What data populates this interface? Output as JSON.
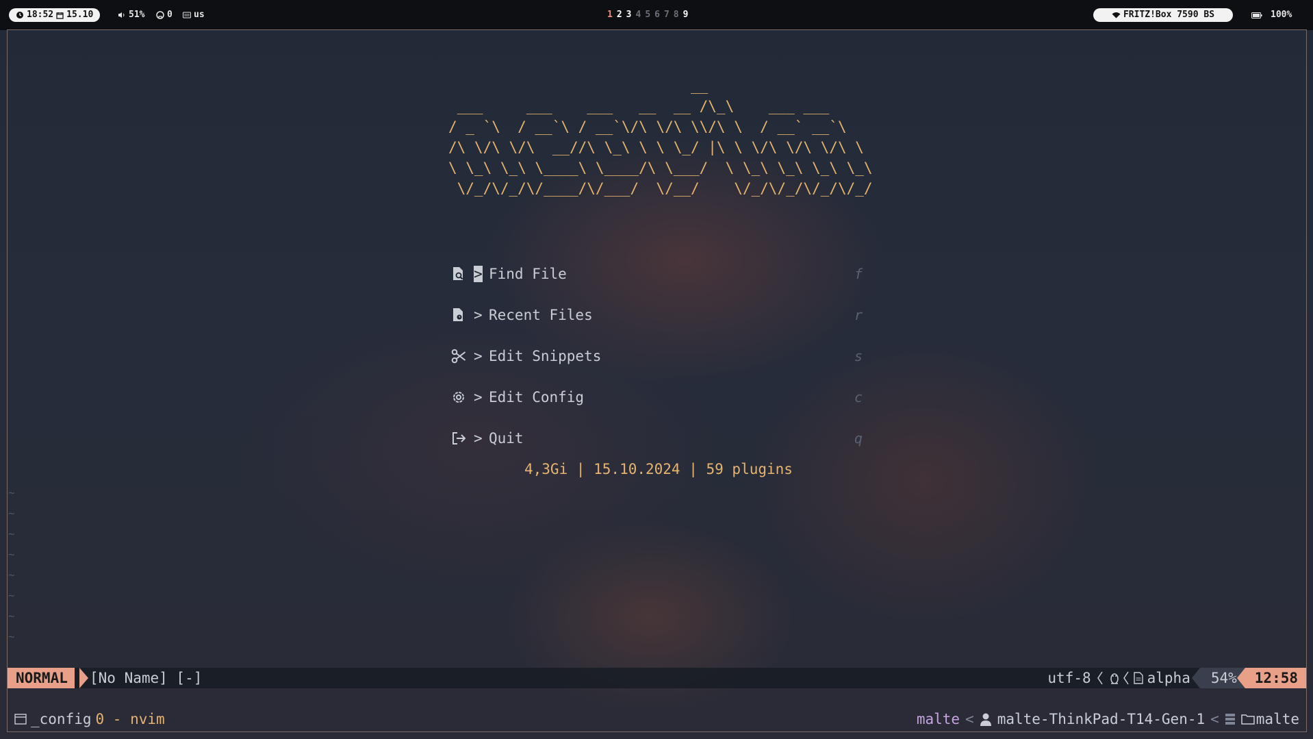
{
  "topbar": {
    "time": "18:52",
    "date": "15.10",
    "volume": "51%",
    "github_count": "0",
    "keyboard_layout": "us",
    "workspaces": [
      {
        "label": "1",
        "state": "active"
      },
      {
        "label": "2",
        "state": "used"
      },
      {
        "label": "3",
        "state": "used"
      },
      {
        "label": "4",
        "state": "empty"
      },
      {
        "label": "5",
        "state": "empty"
      },
      {
        "label": "6",
        "state": "empty"
      },
      {
        "label": "7",
        "state": "empty"
      },
      {
        "label": "8",
        "state": "empty"
      },
      {
        "label": "9",
        "state": "used"
      }
    ],
    "wifi": "FRITZ!Box 7590 BS",
    "battery": "100%"
  },
  "dashboard": {
    "ascii_art": "                            __\n ___     ___    ___   __  __ /\\_\\    ___ ___\n/ _ `\\  / __`\\ / __`\\/\\ \\/\\ \\\\/\\ \\  / __` __`\\\n/\\ \\/\\ \\/\\  __//\\ \\_\\ \\ \\ \\_/ |\\ \\ \\/\\ \\/\\ \\/\\ \\\n\\ \\_\\ \\_\\ \\____\\ \\____/\\ \\___/  \\ \\_\\ \\_\\ \\_\\ \\_\\\n \\/_/\\/_/\\/____/\\/___/  \\/__/    \\/_/\\/_/\\/_/\\/_/",
    "menu": [
      {
        "icon": "file-search-icon",
        "prompt": ">",
        "label": "Find File",
        "key": "f"
      },
      {
        "icon": "file-recent-icon",
        "prompt": ">",
        "label": "Recent Files",
        "key": "r"
      },
      {
        "icon": "scissors-icon",
        "prompt": ">",
        "label": "Edit Snippets",
        "key": "s"
      },
      {
        "icon": "gear-icon",
        "prompt": ">",
        "label": "Edit Config",
        "key": "c"
      },
      {
        "icon": "logout-icon",
        "prompt": ">",
        "label": "Quit",
        "key": "q"
      }
    ],
    "footer": "4,3Gi | 15.10.2024 | 59 plugins",
    "tildes": [
      "~",
      "~",
      "~",
      "~",
      "~",
      "~",
      "~",
      "~"
    ]
  },
  "statusline": {
    "mode": "NORMAL",
    "filename": "[No Name] [-]",
    "encoding": "utf-8",
    "filetype": "alpha",
    "percent": "54%",
    "time": "12:58"
  },
  "tmux": {
    "session": "_config",
    "window": "0 - nvim",
    "user": "malte",
    "separator": "<",
    "host": "malte-ThinkPad-T14-Gen-1",
    "directory": "malte"
  },
  "colors": {
    "accent": "#e8a088",
    "ascii": "#e6b46f",
    "active_workspace": "#f08c7c",
    "user": "#c7a4e0"
  }
}
